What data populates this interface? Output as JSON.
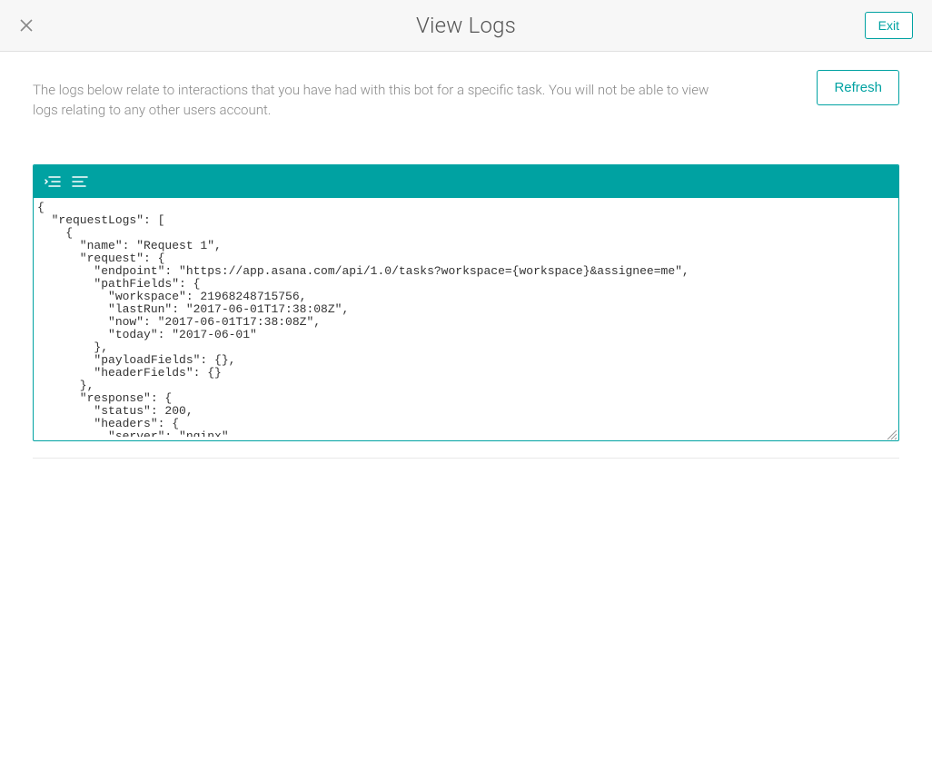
{
  "header": {
    "title": "View Logs",
    "exit_label": "Exit"
  },
  "info": {
    "description": "The logs below relate to interactions that you have had with this bot for a specific task. You will not be able to view logs relating to any other users account.",
    "refresh_label": "Refresh"
  },
  "log_content": "{\n  \"requestLogs\": [\n    {\n      \"name\": \"Request 1\",\n      \"request\": {\n        \"endpoint\": \"https://app.asana.com/api/1.0/tasks?workspace={workspace}&assignee=me\",\n        \"pathFields\": {\n          \"workspace\": 21968248715756,\n          \"lastRun\": \"2017-06-01T17:38:08Z\",\n          \"now\": \"2017-06-01T17:38:08Z\",\n          \"today\": \"2017-06-01\"\n        },\n        \"payloadFields\": {},\n        \"headerFields\": {}\n      },\n      \"response\": {\n        \"status\": 200,\n        \"headers\": {\n          \"server\": \"nginx\","
}
